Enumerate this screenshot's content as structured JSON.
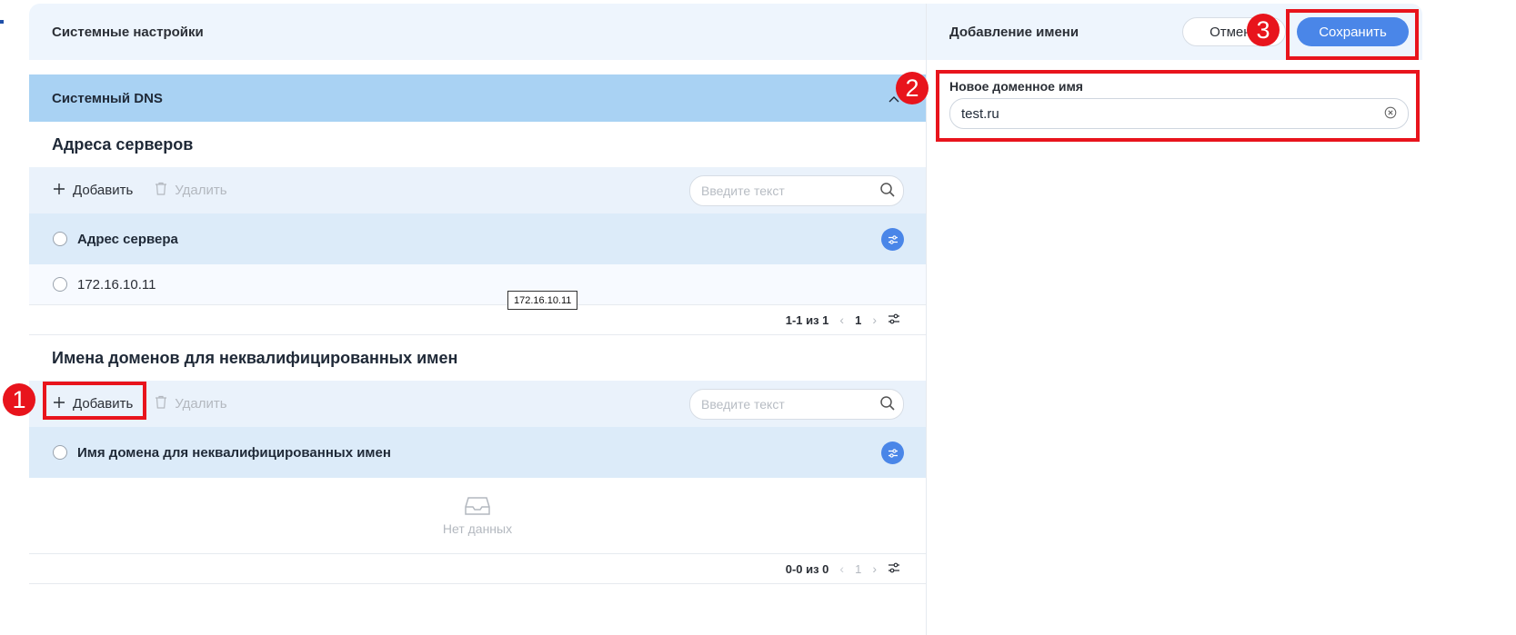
{
  "left_panel": {
    "title": "Системные настройки",
    "dns_section": "Системный DNS",
    "servers": {
      "title": "Адреса серверов",
      "add_label": "Добавить",
      "delete_label": "Удалить",
      "search_placeholder": "Введите текст",
      "column": "Адрес сервера",
      "rows": [
        "172.16.10.11"
      ],
      "tooltip": "172.16.10.11",
      "pager": {
        "range": "1-1 из 1",
        "page": "1"
      }
    },
    "domains": {
      "title": "Имена доменов для неквалифицированных имен",
      "add_label": "Добавить",
      "delete_label": "Удалить",
      "search_placeholder": "Введите текст",
      "column": "Имя домена для неквалифицированных имен",
      "empty_text": "Нет данных",
      "pager": {
        "range": "0-0 из 0",
        "page": "1"
      }
    }
  },
  "right_panel": {
    "title": "Добавление имени",
    "cancel_label": "Отмена",
    "save_label": "Сохранить",
    "field_label": "Новое доменное имя",
    "field_value": "test.ru"
  },
  "annotations": [
    "1",
    "2",
    "3"
  ],
  "colors": {
    "accent": "#4a86e8",
    "highlight": "#e8141c",
    "section_bar": "#a9d2f3"
  }
}
